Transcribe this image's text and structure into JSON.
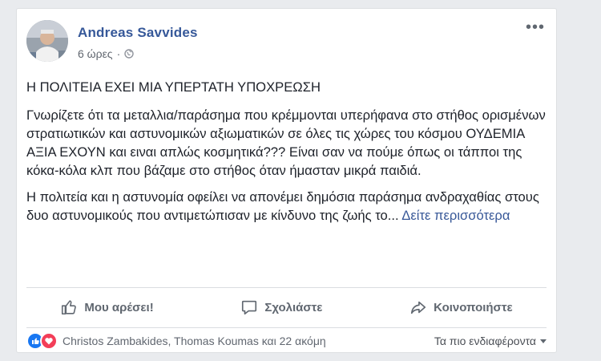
{
  "post": {
    "author": "Andreas Savvides",
    "time": "6 ώρες",
    "separator": "·",
    "title": "Η ΠΟΛΙΤΕΙΑ ΕΧΕΙ ΜΙΑ ΥΠΕΡΤΑΤΗ ΥΠΟΧΡΕΩΣΗ",
    "paragraph_1": "Γνωρίζετε ότι τα μεταλλια/παράσημα που κρέμμονται υπερήφανα στο στήθος ορισμένων στρατιωτικών και αστυνομικών αξιωματικών σε όλες τις χώρες του κόσμου ΟΥΔΕΜΙΑ ΑΞΙΑ ΕΧΟΥΝ και ειναι απλώς κοσμητικά??? Είναι σαν να πούμε όπως οι τάπποι της κόκα-κόλα κλπ που βάζαμε στο στήθος όταν ήμασταν μικρά παιδιά.",
    "paragraph_2": "Η πολιτεία και η αστυνομία οφείλει να απονέμει δημόσια παράσημα ανδραχαθίας στους δυο αστυνομικούς που αντιμετώπισαν με κίνδυνο της ζωής το...",
    "see_more": "Δείτε περισσότερα",
    "more_options": "•••"
  },
  "actions": {
    "like": "Μου αρέσει!",
    "comment": "Σχολιάστε",
    "share": "Κοινοποιήστε"
  },
  "reactions": {
    "names": "Christos Zambakides, Thomas Koumas και 22 ακόμη",
    "sort": "Τα πιο ενδιαφέροντα"
  },
  "colors": {
    "author_link": "#365899",
    "like_reaction": "#1877f2",
    "love_reaction": "#f33e58"
  },
  "icons": [
    "globe-icon",
    "more-options-icon",
    "like-thumb-icon",
    "comment-icon",
    "share-arrow-icon",
    "like-reaction-icon",
    "love-reaction-icon",
    "caret-down-icon"
  ]
}
